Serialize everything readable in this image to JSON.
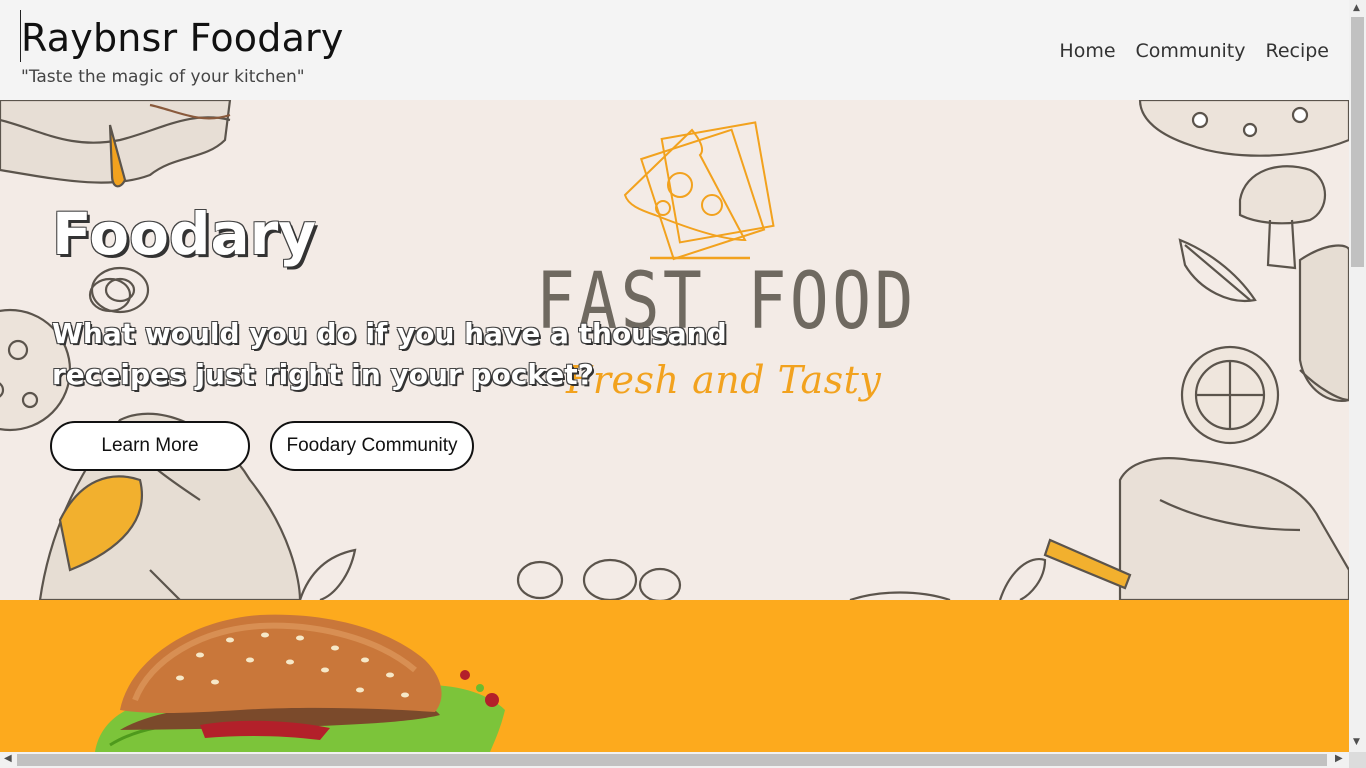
{
  "header": {
    "title": "Raybnsr Foodary",
    "tagline": "\"Taste the magic of your kitchen\"",
    "nav": [
      {
        "label": "Home"
      },
      {
        "label": "Community"
      },
      {
        "label": "Recipe"
      }
    ]
  },
  "hero": {
    "title": "Foodary",
    "question": "What would you do if you have a thousand receipes just right in your pocket?",
    "buttons": {
      "learn_more": "Learn More",
      "community": "Foodary Community"
    },
    "logo": {
      "headline": "FAST FOOD",
      "subline": "Fresh and Tasty"
    }
  },
  "colors": {
    "header_bg": "#f4f4f4",
    "hero_bg": "#f3ebe6",
    "accent_orange": "#fdaa1d",
    "logo_gray": "#6f6960",
    "logo_orange": "#f2a21e"
  },
  "icons": {
    "scroll_up": "▲",
    "scroll_down": "▼",
    "scroll_left": "◀",
    "scroll_right": "▶"
  }
}
